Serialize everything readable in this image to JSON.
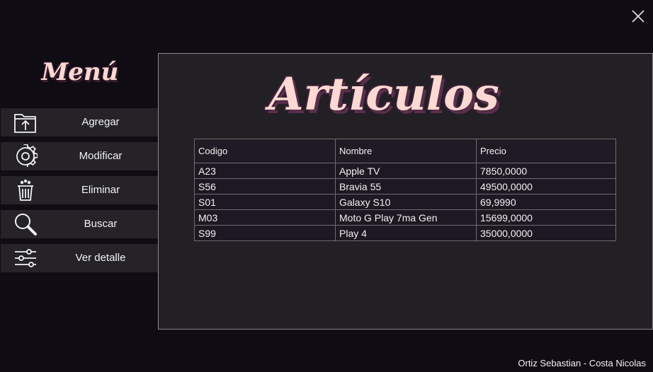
{
  "window": {
    "close_icon": "close-icon"
  },
  "menu": {
    "title": "Menú",
    "items": [
      {
        "label": "Agregar",
        "icon": "folder-upload-icon"
      },
      {
        "label": "Modificar",
        "icon": "gear-icon"
      },
      {
        "label": "Eliminar",
        "icon": "trash-icon"
      },
      {
        "label": "Buscar",
        "icon": "search-icon"
      },
      {
        "label": "Ver detalle",
        "icon": "sliders-icon"
      }
    ]
  },
  "main": {
    "title": "Artículos",
    "table": {
      "headers": [
        "Codigo",
        "Nombre",
        "Precio"
      ],
      "rows": [
        [
          "A23",
          "Apple TV",
          "7850,0000"
        ],
        [
          "S56",
          "Bravia 55",
          "49500,0000"
        ],
        [
          "S01",
          "Galaxy S10",
          "69,9990"
        ],
        [
          "M03",
          "Moto G Play 7ma Gen",
          "15699,0000"
        ],
        [
          "S99",
          "Play 4",
          "35000,0000"
        ]
      ]
    }
  },
  "footer": {
    "authors": "Ortiz Sebastian - Costa Nicolas"
  },
  "colors": {
    "background": "#100c13",
    "panel": "#221f25",
    "menu_item": "#252328",
    "title_pink": "#fcd9d2",
    "title_shadow": "#3a1f33"
  }
}
